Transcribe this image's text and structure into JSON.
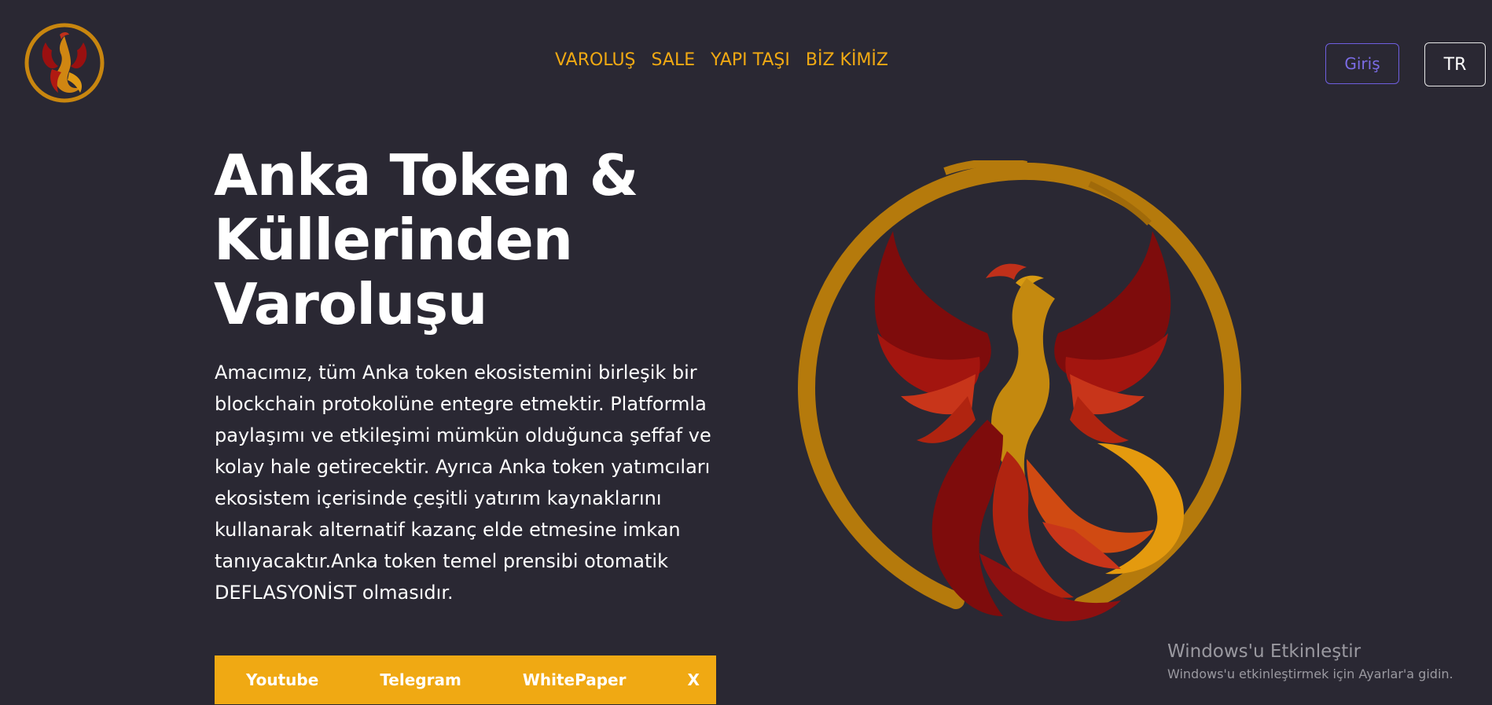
{
  "header": {
    "logo_icon": "phoenix-logo-icon",
    "nav": [
      "VAROLUŞ",
      "SALE",
      "YAPI TAŞI",
      "BİZ KİMİZ"
    ],
    "login_label": "Giriş",
    "language_label": "TR"
  },
  "hero": {
    "title_line1": "Anka Token &",
    "title_line2": "Küllerinden",
    "title_line3": "Varoluşu",
    "description": "Amacımız, tüm Anka token ekosistemini birleşik bir blockchain protokolüne entegre etmektir. Platformla paylaşımı ve etkileşimi mümkün olduğunca şeffaf ve kolay hale getirecektir. Ayrıca Anka token yatımcıları ekosistem içerisinde çeşitli yatırım kaynaklarını kullanarak alternatif kazanç elde etmesine imkan tanıyacaktır.Anka token temel prensibi otomatik DEFLASYONİST olmasıdır.",
    "links": [
      "Youtube",
      "Telegram",
      "WhitePaper",
      "X"
    ],
    "emblem_icon": "phoenix-emblem-icon"
  },
  "watermark": {
    "title": "Windows'u Etkinleştir",
    "subtitle": "Windows'u etkinleştirmek için Ayarlar'a gidin."
  },
  "colors": {
    "background": "#2a2833",
    "accent": "#f0a913",
    "login_border": "#6f5fe0",
    "phoenix_red": "#8b0e0e",
    "phoenix_orange": "#d04a12",
    "phoenix_gold": "#d79a12"
  }
}
